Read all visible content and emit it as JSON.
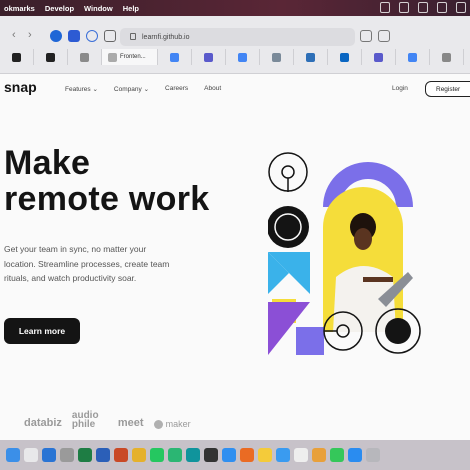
{
  "menubar": {
    "items": [
      "okmarks",
      "Develop",
      "Window",
      "Help"
    ]
  },
  "browser": {
    "url": "learnfi.github.io",
    "active_tab_title": "Fronten...",
    "tabs": [
      {
        "icon": "github-icon",
        "color": "#222"
      },
      {
        "icon": "github-icon",
        "color": "#222"
      },
      {
        "icon": "shield-icon",
        "color": "#2a5bd7"
      },
      {
        "icon": "bitwarden-icon",
        "color": "#175ddc"
      },
      {
        "icon": "gear-icon",
        "color": "#2f6fe0"
      },
      {
        "icon": "leaf-icon",
        "color": "#8aa"
      },
      {
        "icon": "letter-l-icon",
        "color": "#8a8a8a"
      }
    ],
    "other_tabs": [
      {
        "icon": "google-icon",
        "color": "#4285f4"
      },
      {
        "icon": "notion-icon",
        "color": "#5a5acb"
      },
      {
        "icon": "google-icon",
        "color": "#4285f4"
      },
      {
        "icon": "letter-c-icon",
        "color": "#7a8a99"
      },
      {
        "icon": "linkedin-icon",
        "color": "#2e6fb7"
      },
      {
        "icon": "linkedin-icon",
        "color": "#0a66c2"
      },
      {
        "icon": "notion-icon",
        "color": "#5a5acb"
      },
      {
        "icon": "google-icon",
        "color": "#4285f4"
      },
      {
        "icon": "notion-icon",
        "color": "#5a5acb"
      },
      {
        "icon": "letter-a-icon",
        "color": "#888"
      },
      {
        "icon": "box-icon",
        "color": "#e07a2f"
      }
    ]
  },
  "site": {
    "logo": "snap",
    "nav": [
      "Features",
      "Company",
      "Careers",
      "About"
    ],
    "nav_dropdown_marker": "⌄",
    "login": "Login",
    "register": "Register",
    "headline_line1": "Make",
    "headline_line2": "remote work",
    "description": "Get your team in sync, no matter your location. Streamline processes, create team rituals, and watch productivity soar.",
    "cta": "Learn more",
    "clients": [
      "databiz",
      "audio phile",
      "meet",
      "maker"
    ],
    "colors": {
      "purple": "#7b6fe9",
      "yellow": "#f5dd3a",
      "blue": "#3ab2ea",
      "dark": "#141414",
      "violet": "#8b4fd6"
    }
  },
  "dock": {
    "apps": [
      {
        "icon": "finder-icon",
        "color": "#3b8fe8"
      },
      {
        "icon": "launchpad-icon",
        "color": "#e8e8ea"
      },
      {
        "icon": "vscode-icon",
        "color": "#2a74d4"
      },
      {
        "icon": "settings-icon",
        "color": "#9a9a9a"
      },
      {
        "icon": "excel-icon",
        "color": "#1e7d44"
      },
      {
        "icon": "word-icon",
        "color": "#2b5fb8"
      },
      {
        "icon": "powerpoint-icon",
        "color": "#c94926"
      },
      {
        "icon": "chrome-icon",
        "color": "#e5b12c"
      },
      {
        "icon": "spotify-icon",
        "color": "#25c760"
      },
      {
        "icon": "whatsapp-icon",
        "color": "#2bb673"
      },
      {
        "icon": "arduino-icon",
        "color": "#10949c"
      },
      {
        "icon": "terminal-icon",
        "color": "#333"
      },
      {
        "icon": "safari-icon",
        "color": "#2f8ff0"
      },
      {
        "icon": "firefox-icon",
        "color": "#ea6b23"
      },
      {
        "icon": "notes-icon",
        "color": "#f4cb3a"
      },
      {
        "icon": "mail-icon",
        "color": "#3a9bf0"
      },
      {
        "icon": "calendar-icon",
        "color": "#eeeeee"
      },
      {
        "icon": "photos-icon",
        "color": "#e8a03a"
      },
      {
        "icon": "messages-icon",
        "color": "#35c75a"
      },
      {
        "icon": "app-store-icon",
        "color": "#2a8cf0"
      },
      {
        "icon": "trash-icon",
        "color": "#b7b7bc"
      }
    ]
  }
}
